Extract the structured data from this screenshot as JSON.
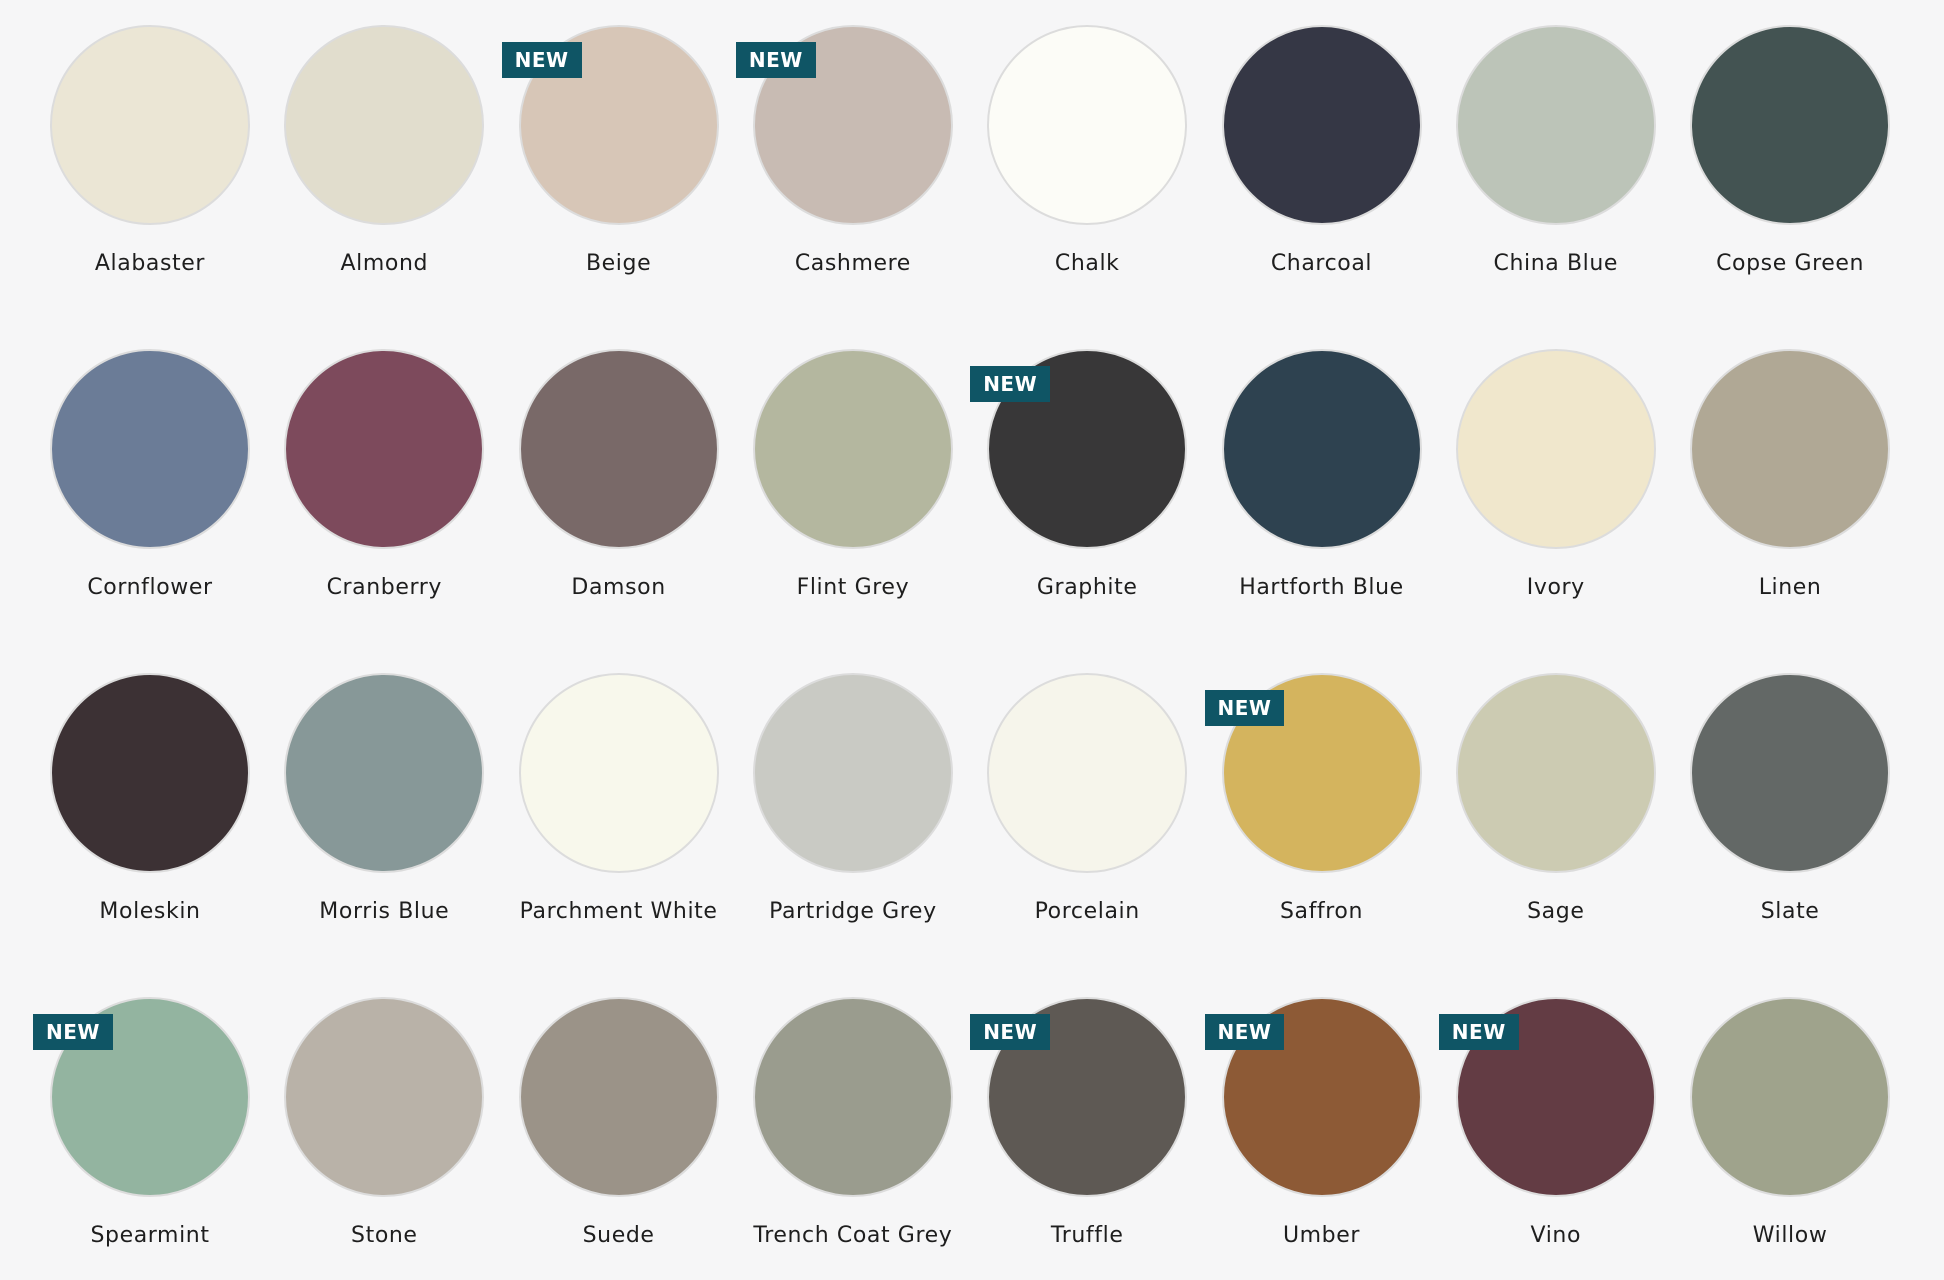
{
  "badge_label": "NEW",
  "colors": [
    {
      "name": "Alabaster",
      "hex": "#ebe6d5",
      "new": false
    },
    {
      "name": "Almond",
      "hex": "#e1ddcd",
      "new": false
    },
    {
      "name": "Beige",
      "hex": "#d7c6b7",
      "new": true
    },
    {
      "name": "Cashmere",
      "hex": "#c8bbb3",
      "new": true
    },
    {
      "name": "Chalk",
      "hex": "#fcfcf7",
      "new": false
    },
    {
      "name": "Charcoal",
      "hex": "#353745",
      "new": false
    },
    {
      "name": "China Blue",
      "hex": "#bcc4b8",
      "new": false
    },
    {
      "name": "Copse Green",
      "hex": "#435352",
      "new": false
    },
    {
      "name": "Cornflower",
      "hex": "#6b7c97",
      "new": false
    },
    {
      "name": "Cranberry",
      "hex": "#7d4a5c",
      "new": false
    },
    {
      "name": "Damson",
      "hex": "#796968",
      "new": false
    },
    {
      "name": "Flint Grey",
      "hex": "#b4b79f",
      "new": false
    },
    {
      "name": "Graphite",
      "hex": "#383738",
      "new": true
    },
    {
      "name": "Hartforth Blue",
      "hex": "#2e4250",
      "new": false
    },
    {
      "name": "Ivory",
      "hex": "#f0e7cc",
      "new": false
    },
    {
      "name": "Linen",
      "hex": "#b0a895",
      "new": false
    },
    {
      "name": "Moleskin",
      "hex": "#3c3134",
      "new": false
    },
    {
      "name": "Morris Blue",
      "hex": "#879898",
      "new": false
    },
    {
      "name": "Parchment White",
      "hex": "#f8f8ec",
      "new": false
    },
    {
      "name": "Partridge Grey",
      "hex": "#c9cac4",
      "new": false
    },
    {
      "name": "Porcelain",
      "hex": "#f6f5eb",
      "new": false
    },
    {
      "name": "Saffron",
      "hex": "#d4b45e",
      "new": true
    },
    {
      "name": "Sage",
      "hex": "#cccbb2",
      "new": false
    },
    {
      "name": "Slate",
      "hex": "#636866",
      "new": false
    },
    {
      "name": "Spearmint",
      "hex": "#93b4a0",
      "new": true
    },
    {
      "name": "Stone",
      "hex": "#b9b2a8",
      "new": false
    },
    {
      "name": "Suede",
      "hex": "#9b9388",
      "new": false
    },
    {
      "name": "Trench Coat Grey",
      "hex": "#9a9c8e",
      "new": false
    },
    {
      "name": "Truffle",
      "hex": "#5e5954",
      "new": true
    },
    {
      "name": "Umber",
      "hex": "#8d5a36",
      "new": true
    },
    {
      "name": "Vino",
      "hex": "#633c44",
      "new": true
    },
    {
      "name": "Willow",
      "hex": "#9fa38c",
      "new": false
    }
  ]
}
